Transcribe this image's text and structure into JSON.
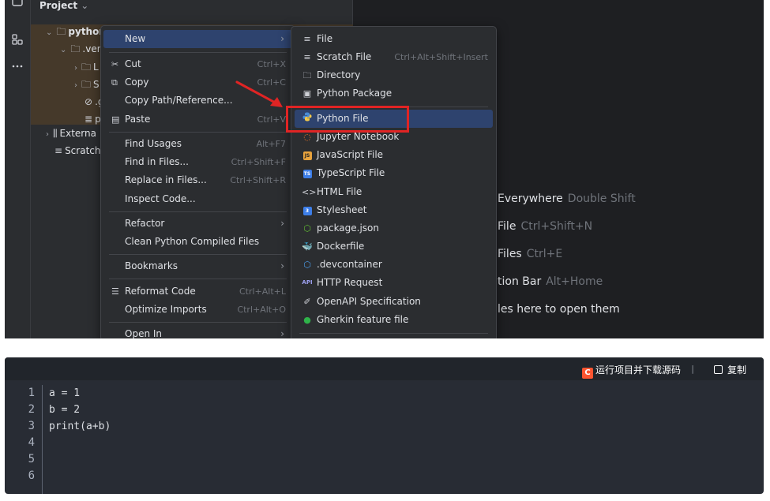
{
  "ide": {
    "project_title": "Project",
    "project_chevron": "⌄",
    "stripe": {
      "project_icon": "folder-icon",
      "structure_icon": "structure-icon",
      "more_icon": "more-icon"
    },
    "tree": [
      {
        "arrow": "⌄",
        "icon": "folder-icon",
        "label": "python"
      },
      {
        "arrow": "⌄",
        "icon": "folder-icon",
        "label": ".ven"
      },
      {
        "arrow": "›",
        "icon": "folder-icon",
        "label": "L"
      },
      {
        "arrow": "›",
        "icon": "folder-icon",
        "label": "S"
      },
      {
        "arrow": "",
        "icon": "ignore-icon",
        "label": ".g"
      },
      {
        "arrow": "",
        "icon": "config-file-icon",
        "label": "p"
      },
      {
        "arrow": "›",
        "icon": "library-icon",
        "label": "Externa"
      },
      {
        "arrow": "",
        "icon": "scratch-icon",
        "label": "Scratch"
      }
    ],
    "hints": [
      {
        "label": "Everywhere",
        "shortcut": "Double Shift"
      },
      {
        "label": "File",
        "shortcut": "Ctrl+Shift+N"
      },
      {
        "label": "Files",
        "shortcut": "Ctrl+E"
      },
      {
        "label": "tion Bar",
        "shortcut": "Alt+Home"
      },
      {
        "label": "les here to open them",
        "shortcut": ""
      }
    ],
    "context_menu": [
      {
        "label": "New",
        "shortcut": "",
        "submenu": true
      },
      {
        "label": "Cut",
        "shortcut": "Ctrl+X",
        "icon": "cut-icon"
      },
      {
        "label": "Copy",
        "shortcut": "Ctrl+C",
        "icon": "copy-icon"
      },
      {
        "label": "Copy Path/Reference...",
        "shortcut": ""
      },
      {
        "label": "Paste",
        "shortcut": "Ctrl+V",
        "icon": "paste-icon"
      },
      {
        "label": "Find Usages",
        "shortcut": "Alt+F7"
      },
      {
        "label": "Find in Files...",
        "shortcut": "Ctrl+Shift+F"
      },
      {
        "label": "Replace in Files...",
        "shortcut": "Ctrl+Shift+R"
      },
      {
        "label": "Inspect Code...",
        "shortcut": ""
      },
      {
        "label": "Refactor",
        "shortcut": "",
        "submenu": true
      },
      {
        "label": "Clean Python Compiled Files",
        "shortcut": ""
      },
      {
        "label": "Bookmarks",
        "shortcut": "",
        "submenu": true
      },
      {
        "label": "Reformat Code",
        "shortcut": "Ctrl+Alt+L",
        "icon": "reformat-icon"
      },
      {
        "label": "Optimize Imports",
        "shortcut": "Ctrl+Alt+O"
      },
      {
        "label": "Open In",
        "shortcut": "",
        "submenu": true
      }
    ],
    "new_submenu": [
      {
        "label": "File",
        "shortcut": "",
        "icon": "file-icon"
      },
      {
        "label": "Scratch File",
        "shortcut": "Ctrl+Alt+Shift+Insert",
        "icon": "scratch-file-icon"
      },
      {
        "label": "Directory",
        "shortcut": "",
        "icon": "directory-icon"
      },
      {
        "label": "Python Package",
        "shortcut": "",
        "icon": "python-package-icon"
      },
      {
        "label": "Python File",
        "shortcut": "",
        "icon": "python-file-icon"
      },
      {
        "label": "Jupyter Notebook",
        "shortcut": "",
        "icon": "jupyter-icon"
      },
      {
        "label": "JavaScript File",
        "shortcut": "",
        "icon": "javascript-icon"
      },
      {
        "label": "TypeScript File",
        "shortcut": "",
        "icon": "typescript-icon"
      },
      {
        "label": "HTML File",
        "shortcut": "",
        "icon": "html-icon"
      },
      {
        "label": "Stylesheet",
        "shortcut": "",
        "icon": "css-icon"
      },
      {
        "label": "package.json",
        "shortcut": "",
        "icon": "npm-icon"
      },
      {
        "label": "Dockerfile",
        "shortcut": "",
        "icon": "docker-icon"
      },
      {
        "label": ".devcontainer",
        "shortcut": "",
        "icon": "devcontainer-icon"
      },
      {
        "label": "HTTP Request",
        "shortcut": "",
        "icon": "api-icon"
      },
      {
        "label": "OpenAPI Specification",
        "shortcut": "",
        "icon": "openapi-icon"
      },
      {
        "label": "Gherkin feature file",
        "shortcut": "",
        "icon": "gherkin-icon"
      }
    ],
    "badges": {
      "js": "JS",
      "ts": "TS",
      "api": "API"
    },
    "colors": {
      "menu_selection": "#2e436e",
      "annotation_red": "#e02424",
      "tree_highlight": "#45392a"
    }
  },
  "code_block": {
    "run_badge": "C",
    "run_label": "运行项目并下载源码",
    "divider": "|",
    "copy_label": "复制",
    "line_numbers": [
      "1",
      "2",
      "3",
      "4",
      "5",
      "6"
    ],
    "lines": [
      "a = 1",
      "b = 2",
      "print(a+b)",
      "",
      "",
      ""
    ]
  }
}
